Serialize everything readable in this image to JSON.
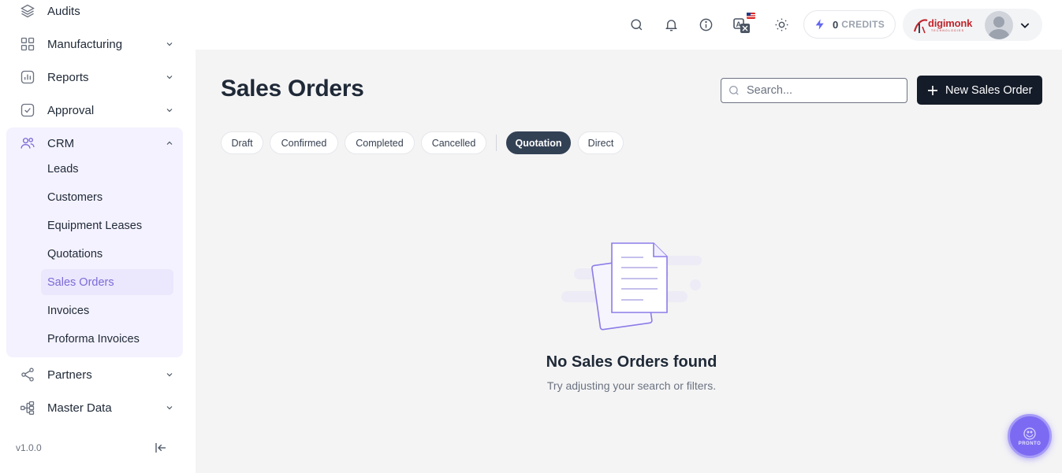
{
  "sidebar": {
    "items": [
      {
        "label": "Audits",
        "icon": "layers-icon"
      },
      {
        "label": "Manufacturing",
        "icon": "grid-icon"
      },
      {
        "label": "Reports",
        "icon": "chart-icon"
      },
      {
        "label": "Approval",
        "icon": "check-square-icon"
      },
      {
        "label": "CRM",
        "icon": "users-icon"
      },
      {
        "label": "Partners",
        "icon": "share-icon"
      },
      {
        "label": "Master Data",
        "icon": "hierarchy-icon"
      }
    ],
    "crm_sub": [
      "Leads",
      "Customers",
      "Equipment Leases",
      "Quotations",
      "Sales Orders",
      "Invoices",
      "Proforma Invoices"
    ],
    "active_sub": "Sales Orders",
    "version": "v1.0.0"
  },
  "topbar": {
    "credits_count": "0",
    "credits_label": "CREDITS",
    "logo_text": "digimonk",
    "logo_tagline": "TECHNOLOGIES"
  },
  "main": {
    "title": "Sales Orders",
    "search_placeholder": "Search...",
    "new_button": "New Sales Order",
    "filters": [
      "Draft",
      "Confirmed",
      "Completed",
      "Cancelled",
      "Quotation",
      "Direct"
    ],
    "active_filter": "Quotation",
    "empty_title": "No Sales Orders found",
    "empty_subtitle": "Try adjusting your search or filters."
  },
  "assistant": {
    "label": "PRONTO"
  },
  "colors": {
    "accent": "#7c6bf2",
    "primary_button": "#151c29",
    "active_chip": "#334155",
    "crm_bg": "#f4f2fe"
  }
}
